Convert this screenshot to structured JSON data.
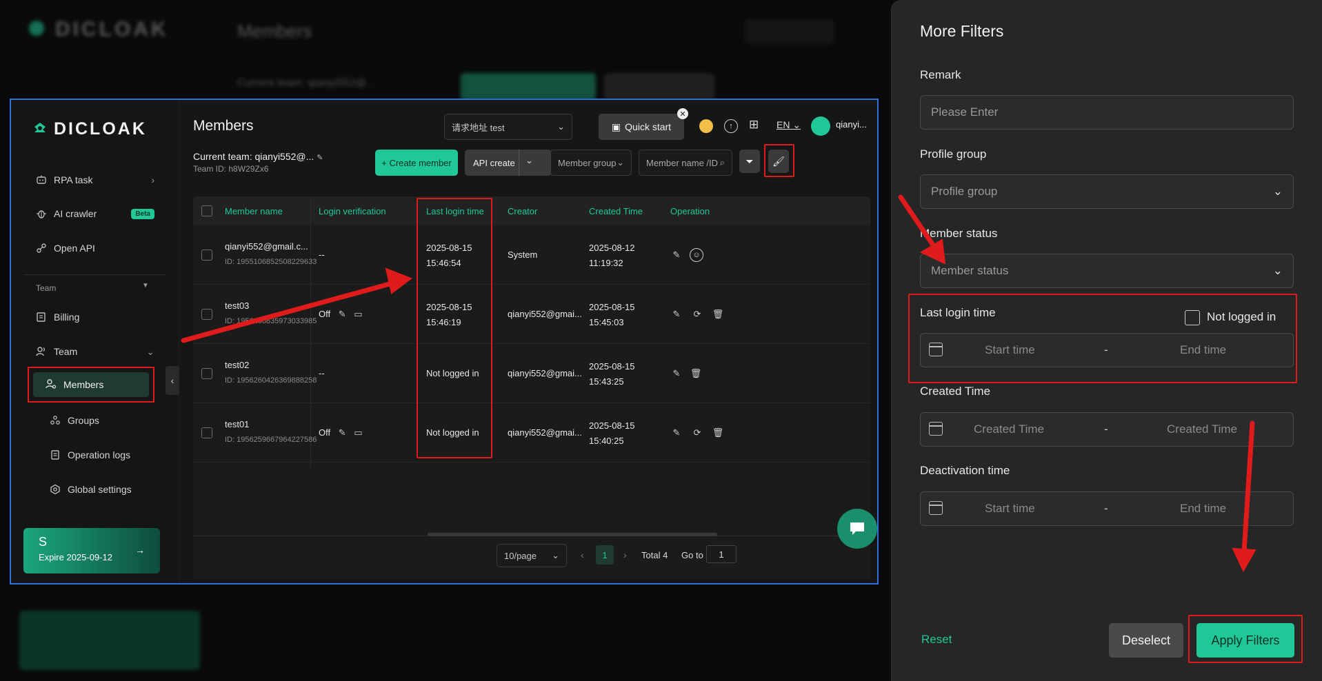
{
  "background": {
    "title": "Members",
    "logo_text": "DICLOAK",
    "current_team_label": "Current team: qianyi552@..."
  },
  "app": {
    "logo_text": "DICLOAK",
    "page_title": "Members",
    "request_select": "请求地址 test",
    "quick_start": "Quick start",
    "lang": "EN",
    "username": "qianyi...",
    "current_team": "Current team: qianyi552@...",
    "team_id_label": "Team ID:",
    "team_id": "h8W29Zx6",
    "create_member": "+ Create member",
    "api_create": "API create",
    "member_group_placeholder": "Member group",
    "member_search_placeholder": "Member name /ID"
  },
  "sidebar": {
    "items": [
      {
        "label": "RPA task",
        "icon": "robot-icon"
      },
      {
        "label": "AI crawler",
        "icon": "bug-icon",
        "badge": "Beta"
      },
      {
        "label": "Open API",
        "icon": "link-icon"
      }
    ],
    "section_team": "Team",
    "team_group": "Team",
    "sub_items": [
      {
        "label": "Billing",
        "icon": "billing-icon"
      },
      {
        "label": "Members",
        "icon": "members-icon"
      },
      {
        "label": "Groups",
        "icon": "groups-icon"
      },
      {
        "label": "Operation logs",
        "icon": "logs-icon"
      },
      {
        "label": "Global settings",
        "icon": "settings-icon"
      }
    ],
    "plan": {
      "letter": "S",
      "expire": "Expire 2025-09-12"
    }
  },
  "table": {
    "headers": [
      "Member name",
      "Login verification",
      "Last login time",
      "Creator",
      "Created Time",
      "Operation"
    ],
    "rows": [
      {
        "name": "qianyi552@gmail.c...",
        "id": "ID: 1955106852508229633",
        "login_verification": "--",
        "last_login_date": "2025-08-15",
        "last_login_time": "15:46:54",
        "creator": "System",
        "created_date": "2025-08-12",
        "created_time": "11:19:32"
      },
      {
        "name": "test03",
        "id": "ID: 1956260835973033985",
        "login_verification": "Off",
        "last_login_date": "2025-08-15",
        "last_login_time": "15:46:19",
        "creator": "qianyi552@gmai...",
        "created_date": "2025-08-15",
        "created_time": "15:45:03"
      },
      {
        "name": "test02",
        "id": "ID: 1956260426369888258",
        "login_verification": "--",
        "last_login_date": "Not logged in",
        "last_login_time": "",
        "creator": "qianyi552@gmai...",
        "created_date": "2025-08-15",
        "created_time": "15:43:25"
      },
      {
        "name": "test01",
        "id": "ID: 1956259667964227586",
        "login_verification": "Off",
        "last_login_date": "Not logged in",
        "last_login_time": "",
        "creator": "qianyi552@gmai...",
        "created_date": "2025-08-15",
        "created_time": "15:40:25"
      }
    ]
  },
  "pagination": {
    "page_size": "10/page",
    "current_page": "1",
    "total": "Total 4",
    "goto_label": "Go to",
    "goto_value": "1"
  },
  "drawer": {
    "title": "More Filters",
    "remark_label": "Remark",
    "remark_placeholder": "Please Enter",
    "profile_group_label": "Profile group",
    "profile_group_placeholder": "Profile group",
    "member_status_label": "Member status",
    "member_status_placeholder": "Member status",
    "last_login_label": "Last login time",
    "not_logged_in_label": "Not logged in",
    "start_time": "Start time",
    "end_time": "End time",
    "dash": "-",
    "created_time_label": "Created Time",
    "created_time_start": "Created Time",
    "created_time_end": "Created Time",
    "deactivation_label": "Deactivation time",
    "deact_start": "Start time",
    "deact_end": "End time",
    "reset": "Reset",
    "deselect": "Deselect",
    "apply": "Apply Filters"
  },
  "colors": {
    "accent": "#1fc896",
    "highlight": "#e01b1b",
    "frame": "#2f6fe0"
  }
}
